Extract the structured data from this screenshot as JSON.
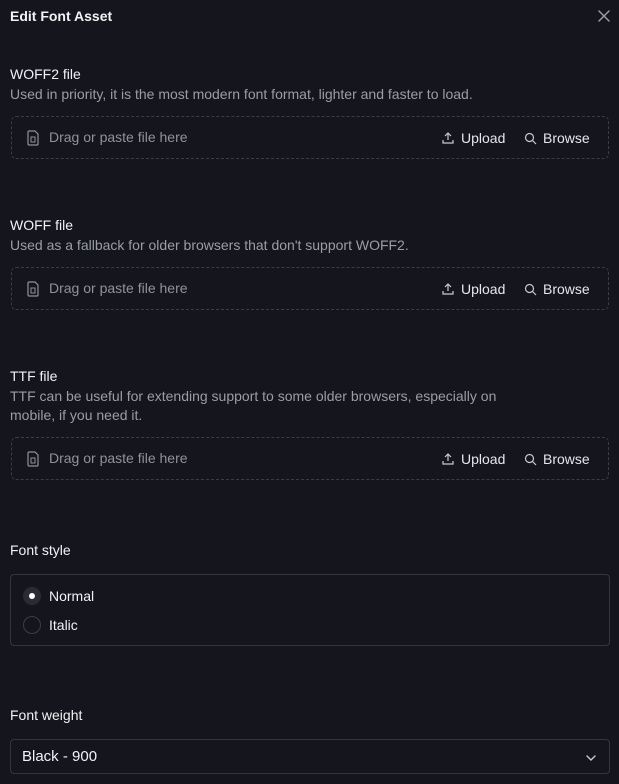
{
  "header": {
    "title": "Edit Font Asset",
    "close_icon": "close-icon"
  },
  "dropzone_common": {
    "placeholder": "Drag or paste file here",
    "upload_label": "Upload",
    "browse_label": "Browse",
    "file_icon": "file-icon",
    "upload_icon": "upload-icon",
    "search_icon": "search-icon"
  },
  "woff2": {
    "title": "WOFF2 file",
    "description": "Used in priority, it is the most modern font format, lighter and faster to load.",
    "placeholder": "Drag or paste file here",
    "upload_label": "Upload",
    "browse_label": "Browse"
  },
  "woff": {
    "title": "WOFF file",
    "description": "Used as a fallback for older browsers that don't support WOFF2.",
    "placeholder": "Drag or paste file here",
    "upload_label": "Upload",
    "browse_label": "Browse"
  },
  "ttf": {
    "title": "TTF file",
    "description": "TTF can be useful for extending support to some older browsers, especially on mobile, if you need it.",
    "placeholder": "Drag or paste file here",
    "upload_label": "Upload",
    "browse_label": "Browse"
  },
  "font_style": {
    "title": "Font style",
    "options": [
      {
        "label": "Normal",
        "checked": true
      },
      {
        "label": "Italic",
        "checked": false
      }
    ]
  },
  "font_weight": {
    "title": "Font weight",
    "selected": "Black - 900"
  },
  "colors": {
    "background": "#15161d",
    "text": "#e6e7ec",
    "muted": "#9a9ca7",
    "border": "#34363f"
  }
}
